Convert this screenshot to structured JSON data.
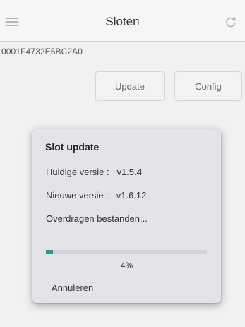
{
  "header": {
    "title": "Sloten"
  },
  "device": {
    "id": "0001F4732E5BC2A0"
  },
  "toolbar": {
    "update_label": "Update",
    "config_label": "Config"
  },
  "dialog": {
    "title": "Slot update",
    "current_version": {
      "label": "Huidige versie :",
      "value": "v1.5.4"
    },
    "new_version": {
      "label": "Nieuwe versie :",
      "value": "v1.6.12"
    },
    "status": "Overdragen bestanden...",
    "progress": {
      "percent_text": "4%",
      "fraction": 0.04
    },
    "cancel_label": "Annuleren"
  },
  "colors": {
    "accent": "#1c9e8f",
    "dialog_bg": "#e4e4e8"
  },
  "icons": {
    "menu": "hamburger-menu-icon",
    "refresh": "refresh-icon"
  }
}
